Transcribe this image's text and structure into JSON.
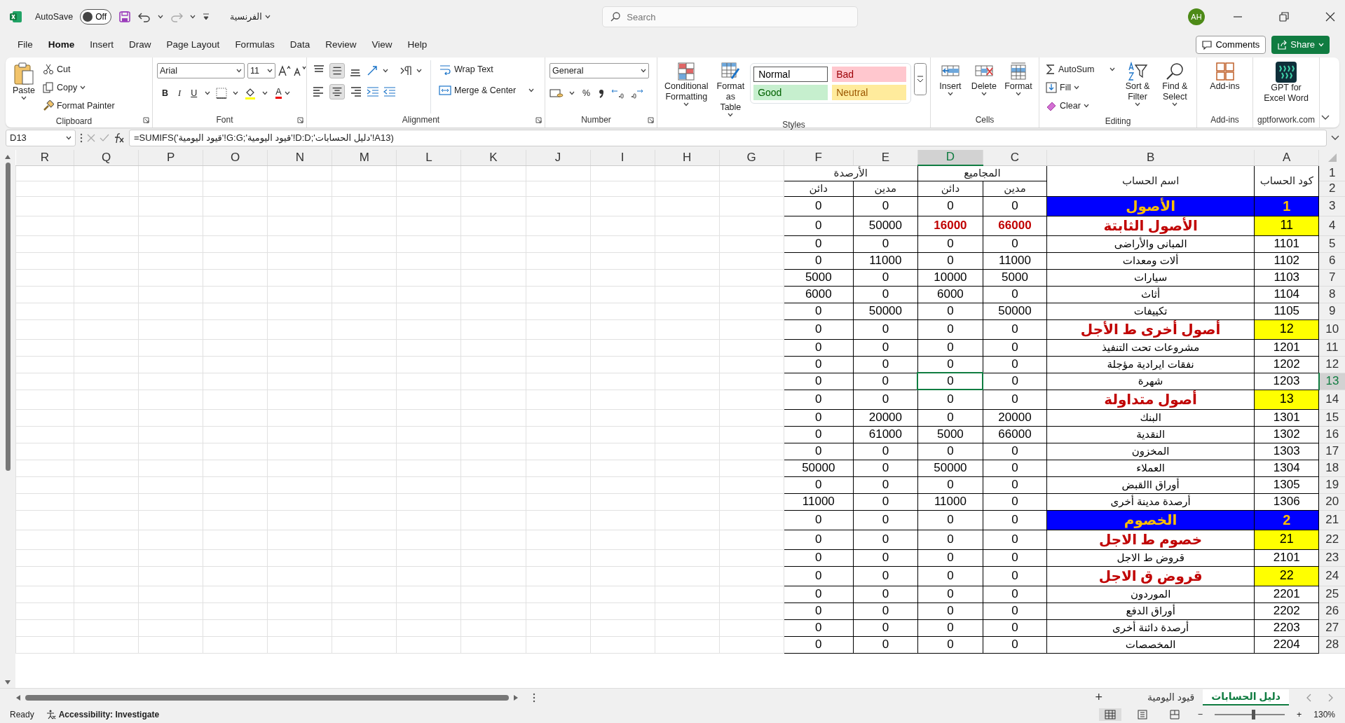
{
  "title_bar": {
    "autosave_label": "AutoSave",
    "autosave_toggle": {
      "label": "Off",
      "on": false
    },
    "file_name": "الفرنسية",
    "search": {
      "placeholder": "Search"
    },
    "avatar": "AH"
  },
  "menu_tabs": [
    {
      "label": "File",
      "selected": false
    },
    {
      "label": "Home",
      "selected": true
    },
    {
      "label": "Insert",
      "selected": false
    },
    {
      "label": "Draw",
      "selected": false
    },
    {
      "label": "Page Layout",
      "selected": false
    },
    {
      "label": "Formulas",
      "selected": false
    },
    {
      "label": "Data",
      "selected": false
    },
    {
      "label": "Review",
      "selected": false
    },
    {
      "label": "View",
      "selected": false
    },
    {
      "label": "Help",
      "selected": false
    }
  ],
  "comments_button": "Comments",
  "share_button": "Share",
  "ribbon": {
    "clipboard": {
      "label": "Clipboard",
      "paste": "Paste",
      "cut": "Cut",
      "copy": "Copy",
      "format_painter": "Format Painter"
    },
    "font": {
      "label": "Font",
      "font_name": "Arial",
      "font_size": "11",
      "bold": "B",
      "italic": "I",
      "underline": "U",
      "font_color": "A"
    },
    "alignment": {
      "label": "Alignment",
      "wrap_text": "Wrap Text",
      "merge_center": "Merge & Center",
      "middle_align_on": true,
      "center_align_on": true
    },
    "number": {
      "label": "Number",
      "format": "General",
      "percent": "%"
    },
    "styles": {
      "label": "Styles",
      "conditional_formatting": "Conditional Formatting",
      "format_as_table": "Format as Table",
      "cell_styles": [
        {
          "label": "Normal",
          "kind": "normal"
        },
        {
          "label": "Bad",
          "kind": "bad"
        },
        {
          "label": "Good",
          "kind": "good"
        },
        {
          "label": "Neutral",
          "kind": "neutral"
        }
      ]
    },
    "cells": {
      "label": "Cells",
      "buttons": [
        "Insert",
        "Delete",
        "Format"
      ]
    },
    "editing": {
      "label": "Editing",
      "autosum": "AutoSum",
      "fill": "Fill",
      "clear": "Clear",
      "sort_filter": "Sort & Filter",
      "find_select": "Find & Select"
    },
    "addins": {
      "label": "Add-ins",
      "button": "Add-ins"
    },
    "gpt": {
      "label": "gptforwork.com",
      "button": "GPT for Excel Word"
    }
  },
  "formula_bar": {
    "name_box": "D13",
    "formula": "=SUMIFS('قيود اليومية'!G:G;'قيود اليومية'!D:D;'دليل الحسابات'!A13)"
  },
  "columns": [
    {
      "label": "R",
      "selected": false
    },
    {
      "label": "Q",
      "selected": false
    },
    {
      "label": "P",
      "selected": false
    },
    {
      "label": "O",
      "selected": false
    },
    {
      "label": "N",
      "selected": false
    },
    {
      "label": "M",
      "selected": false
    },
    {
      "label": "L",
      "selected": false
    },
    {
      "label": "K",
      "selected": false
    },
    {
      "label": "J",
      "selected": false
    },
    {
      "label": "I",
      "selected": false
    },
    {
      "label": "H",
      "selected": false
    },
    {
      "label": "G",
      "selected": false
    },
    {
      "label": "F",
      "selected": false
    },
    {
      "label": "E",
      "selected": false
    },
    {
      "label": "D",
      "selected": true
    },
    {
      "label": "C",
      "selected": false
    },
    {
      "label": "B",
      "selected": false
    },
    {
      "label": "A",
      "selected": false
    }
  ],
  "row_numbers": [
    "1",
    "2",
    "3",
    "4",
    "5",
    "6",
    "7",
    "8",
    "9",
    "10",
    "11",
    "12",
    "13",
    "14",
    "15",
    "16",
    "17",
    "18",
    "19",
    "20",
    "21",
    "22",
    "23",
    "24",
    "25",
    "26",
    "27",
    "28"
  ],
  "header": {
    "groups": [
      {
        "label": "المجاميع",
        "credit": "دائن",
        "debit": "مدين"
      },
      {
        "label": "الأرصدة",
        "credit": "دائن",
        "debit": "مدين"
      }
    ],
    "account_name": "اسم الحساب",
    "account_code": "كود الحساب"
  },
  "rows": [
    {
      "kind": "class",
      "values": [
        "0",
        "0",
        "0",
        "0"
      ],
      "name": "الأصول",
      "code": "1",
      "totals_highlighted": false,
      "selected": false
    },
    {
      "kind": "group",
      "values": [
        "0",
        "50000",
        "16000",
        "66000"
      ],
      "name": "الأصول الثابتة",
      "code": "11",
      "totals_highlighted": true,
      "selected": false
    },
    {
      "kind": "account",
      "values": [
        "0",
        "0",
        "0",
        "0"
      ],
      "name": "المبانى والأراضى",
      "code": "1101",
      "totals_highlighted": false,
      "selected": false
    },
    {
      "kind": "account",
      "values": [
        "0",
        "11000",
        "0",
        "11000"
      ],
      "name": "ألات ومعدات",
      "code": "1102",
      "totals_highlighted": false,
      "selected": false
    },
    {
      "kind": "account",
      "values": [
        "5000",
        "0",
        "10000",
        "5000"
      ],
      "name": "سيارات",
      "code": "1103",
      "totals_highlighted": false,
      "selected": false
    },
    {
      "kind": "account",
      "values": [
        "6000",
        "0",
        "6000",
        "0"
      ],
      "name": "أثاث",
      "code": "1104",
      "totals_highlighted": false,
      "selected": false
    },
    {
      "kind": "account",
      "values": [
        "0",
        "50000",
        "0",
        "50000"
      ],
      "name": "تكييفات",
      "code": "1105",
      "totals_highlighted": false,
      "selected": false
    },
    {
      "kind": "group",
      "values": [
        "0",
        "0",
        "0",
        "0"
      ],
      "name": "أصول أخرى ط الأجل",
      "code": "12",
      "totals_highlighted": false,
      "selected": false
    },
    {
      "kind": "account",
      "values": [
        "0",
        "0",
        "0",
        "0"
      ],
      "name": "مشروعات تحت التنفيذ",
      "code": "1201",
      "totals_highlighted": false,
      "selected": false
    },
    {
      "kind": "account",
      "values": [
        "0",
        "0",
        "0",
        "0"
      ],
      "name": "نفقات ايرادية مؤجلة",
      "code": "1202",
      "totals_highlighted": false,
      "selected": false
    },
    {
      "kind": "account",
      "values": [
        "0",
        "0",
        "0",
        "0"
      ],
      "name": "شهرة",
      "code": "1203",
      "totals_highlighted": false,
      "selected": true
    },
    {
      "kind": "group",
      "values": [
        "0",
        "0",
        "0",
        "0"
      ],
      "name": "أصول متداولة",
      "code": "13",
      "totals_highlighted": false,
      "selected": false
    },
    {
      "kind": "account",
      "values": [
        "0",
        "20000",
        "0",
        "20000"
      ],
      "name": "البنك",
      "code": "1301",
      "totals_highlighted": false,
      "selected": false
    },
    {
      "kind": "account",
      "values": [
        "0",
        "61000",
        "5000",
        "66000"
      ],
      "name": "النقدية",
      "code": "1302",
      "totals_highlighted": false,
      "selected": false
    },
    {
      "kind": "account",
      "values": [
        "0",
        "0",
        "0",
        "0"
      ],
      "name": "المخزون",
      "code": "1303",
      "totals_highlighted": false,
      "selected": false
    },
    {
      "kind": "account",
      "values": [
        "50000",
        "0",
        "50000",
        "0"
      ],
      "name": "العملاء",
      "code": "1304",
      "totals_highlighted": false,
      "selected": false
    },
    {
      "kind": "account",
      "values": [
        "0",
        "0",
        "0",
        "0"
      ],
      "name": "أوراق االقبض",
      "code": "1305",
      "totals_highlighted": false,
      "selected": false
    },
    {
      "kind": "account",
      "values": [
        "11000",
        "0",
        "11000",
        "0"
      ],
      "name": "أرصدة  مدينة أخرى",
      "code": "1306",
      "totals_highlighted": false,
      "selected": false
    },
    {
      "kind": "class",
      "values": [
        "0",
        "0",
        "0",
        "0"
      ],
      "name": "الخصوم",
      "code": "2",
      "totals_highlighted": false,
      "selected": false
    },
    {
      "kind": "group",
      "values": [
        "0",
        "0",
        "0",
        "0"
      ],
      "name": "خصوم ط الاجل",
      "code": "21",
      "totals_highlighted": false,
      "selected": false
    },
    {
      "kind": "account",
      "values": [
        "0",
        "0",
        "0",
        "0"
      ],
      "name": "قروض ط الاجل",
      "code": "2101",
      "totals_highlighted": false,
      "selected": false
    },
    {
      "kind": "group",
      "values": [
        "0",
        "0",
        "0",
        "0"
      ],
      "name": "قروض ق الاجل",
      "code": "22",
      "totals_highlighted": false,
      "selected": false
    },
    {
      "kind": "account",
      "values": [
        "0",
        "0",
        "0",
        "0"
      ],
      "name": "الموردون",
      "code": "2201",
      "totals_highlighted": false,
      "selected": false
    },
    {
      "kind": "account",
      "values": [
        "0",
        "0",
        "0",
        "0"
      ],
      "name": "أوراق الدفع",
      "code": "2202",
      "totals_highlighted": false,
      "selected": false
    },
    {
      "kind": "account",
      "values": [
        "0",
        "0",
        "0",
        "0"
      ],
      "name": "أرصدة دائنة أخرى",
      "code": "2203",
      "totals_highlighted": false,
      "selected": false
    },
    {
      "kind": "account",
      "values": [
        "0",
        "0",
        "0",
        "0"
      ],
      "name": "المخصصات",
      "code": "2204",
      "totals_highlighted": false,
      "selected": false
    }
  ],
  "sheet_tabs": [
    {
      "label": "دليل الحسابات",
      "selected": true
    },
    {
      "label": "قيود اليومية",
      "selected": false
    }
  ],
  "add_sheet": "+",
  "status_bar": {
    "ready": "Ready",
    "accessibility": "Accessibility: Investigate",
    "zoom_out": "−",
    "zoom_in": "+",
    "zoom": {
      "level": 0.55,
      "label": "130%"
    }
  }
}
